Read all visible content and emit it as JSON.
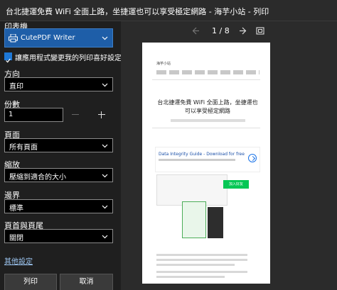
{
  "window": {
    "title": "台北捷運免費 WiFi 全面上路，坐捷運也可以享受極定網路 - 海芋小站 - 列印"
  },
  "printer": {
    "section_label": "印表機",
    "selected": "CutePDF Writer"
  },
  "app_prefs": {
    "checkbox_label": "讓應用程式變更我的列印喜好設定",
    "checked": true
  },
  "orientation": {
    "label": "方向",
    "value": "直印"
  },
  "copies": {
    "label": "份數",
    "value": "1"
  },
  "pages": {
    "label": "頁面",
    "value": "所有頁面"
  },
  "scale": {
    "label": "縮放",
    "value": "壓縮到適合的大小"
  },
  "margins": {
    "label": "邊界",
    "value": "標準"
  },
  "headers_footers": {
    "label": "頁首與頁尾",
    "value": "關閉"
  },
  "more_settings": {
    "label": "其他設定"
  },
  "buttons": {
    "print": "列印",
    "cancel": "取消"
  },
  "preview": {
    "page_indicator": "1 / 8",
    "site_name": "海芋小站",
    "article_title": "台北捷運免費 WiFi 全面上路，坐捷運也可以享受極定網路",
    "ad_title": "Data Integrity Guide - Download for free",
    "line_badge": "加入好友",
    "accent_colors": {
      "print_select": "#1e5ea8",
      "checkbox": "#1e78d6",
      "line_green": "#06c755",
      "ad_link": "#1a4fa8"
    }
  },
  "icons": [
    "printer-icon",
    "chevron-down-icon",
    "prev-page-icon",
    "next-page-icon",
    "fit-page-icon",
    "checkmark-icon",
    "minus-icon",
    "plus-icon"
  ]
}
